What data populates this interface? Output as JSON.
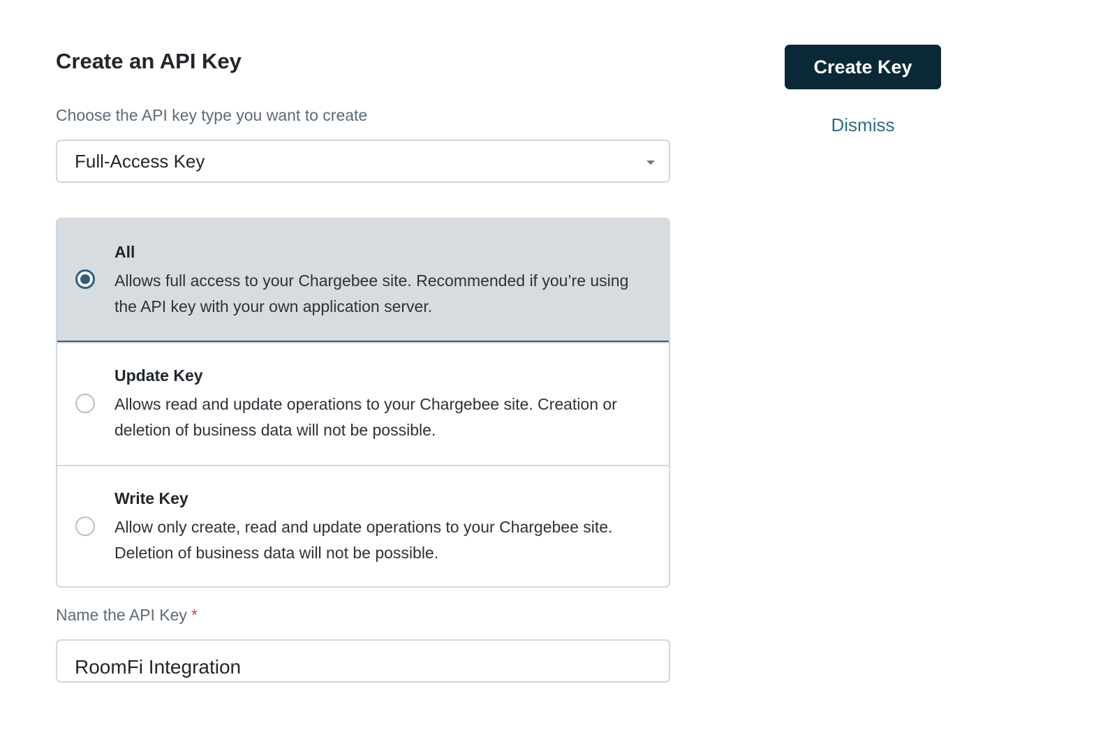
{
  "header": {
    "title": "Create an API Key"
  },
  "actions": {
    "create_label": "Create Key",
    "dismiss_label": "Dismiss"
  },
  "key_type": {
    "label": "Choose the API key type you want to create",
    "selected": "Full-Access Key"
  },
  "permissions": {
    "options": [
      {
        "title": "All",
        "description": "Allows full access to your Chargebee site. Recommended if you’re using the API key with your own application server.",
        "checked": true
      },
      {
        "title": "Update Key",
        "description": "Allows read and update operations to your Chargebee site. Creation or deletion of business data will not be possible.",
        "checked": false
      },
      {
        "title": "Write Key",
        "description": "Allow only create, read and update operations to your Chargebee site. Deletion of business data will not be possible.",
        "checked": false
      }
    ]
  },
  "name_field": {
    "label": "Name the API Key",
    "required_mark": "*",
    "value": "RoomFi Integration"
  },
  "colors": {
    "primary_button": "#0b2836",
    "accent": "#2f5f7e",
    "link": "#2f6a8a",
    "selected_bg": "#d7dce1",
    "required": "#d64545"
  }
}
